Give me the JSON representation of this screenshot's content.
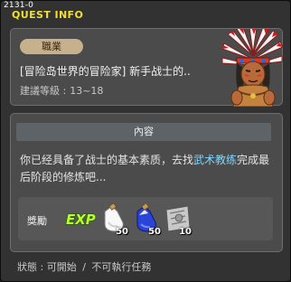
{
  "window": {
    "quest_id": "2131-0",
    "title": "QUEST INFO"
  },
  "header": {
    "job_badge": "職業",
    "quest_name": "[冒险岛世界的冒险家] 新手战士的..",
    "level_label": "建議等級 :",
    "level_range": "13~18",
    "npc_icon": "native-chief-npc-icon"
  },
  "content": {
    "header": "內容",
    "desc_before": "你已经具备了战士的基本素质，去找",
    "desc_highlight": "武术教练",
    "desc_after": "完成最后阶段的修炼吧...",
    "highlight_color": "#7ed7ff"
  },
  "reward": {
    "label": "獎勵",
    "items": [
      {
        "icon": "exp-icon",
        "qty": ""
      },
      {
        "icon": "white-potion-icon",
        "qty": "50"
      },
      {
        "icon": "blue-potion-icon",
        "qty": "50"
      },
      {
        "icon": "scroll-map-icon",
        "qty": "10"
      }
    ]
  },
  "status": {
    "label": "狀態 :",
    "state": "可開始",
    "separator": "/",
    "note": "不可執行任務"
  },
  "colors": {
    "title": "#f0e030",
    "badge": "#c7b18d",
    "panel": "#4b4b4b"
  }
}
